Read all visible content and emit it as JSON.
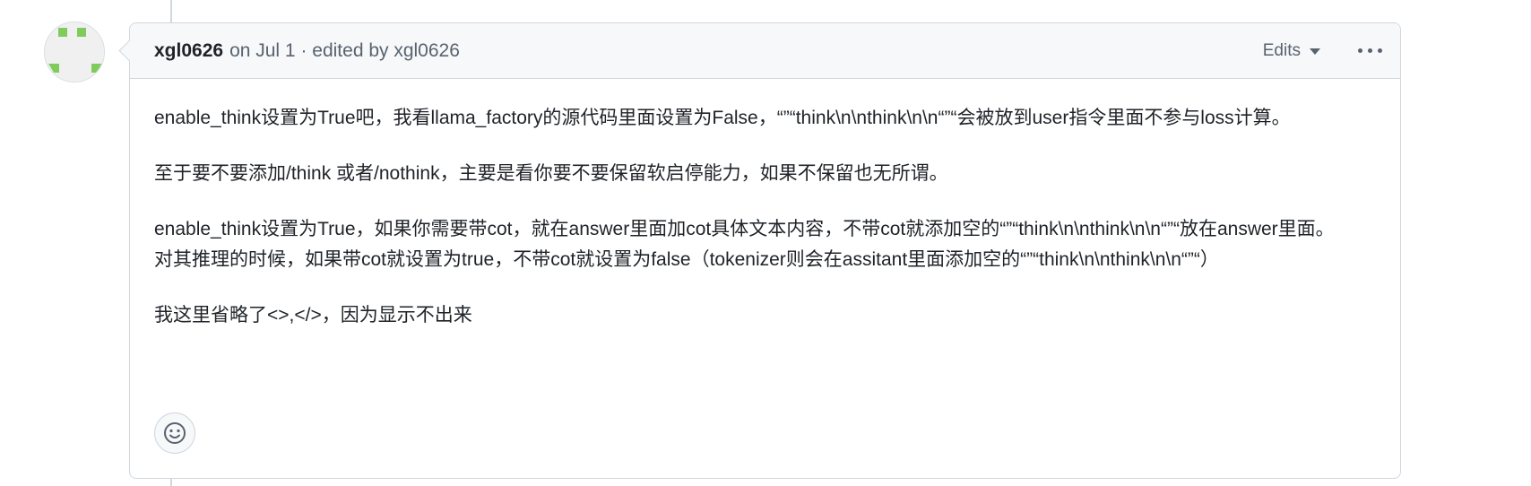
{
  "comment": {
    "author": "xgl0626",
    "meta": "on Jul 1 · edited by xgl0626",
    "edits_label": "Edits",
    "paragraphs": [
      "enable_think设置为True吧，我看llama_factory的源代码里面设置为False，“”“think\\n\\nthink\\n\\n“”“会被放到user指令里面不参与loss计算。",
      "至于要不要添加/think 或者/nothink，主要是看你要不要保留软启停能力，如果不保留也无所谓。",
      "enable_think设置为True，如果你需要带cot，就在answer里面加cot具体文本内容，不带cot就添加空的“”“think\\n\\nthink\\n\\n“”“放在answer里面。",
      "对其推理的时候，如果带cot就设置为true，不带cot就设置为false（tokenizer则会在assitant里面添加空的“”“think\\n\\nthink\\n\\n“”“）",
      "我这里省略了<>,</>，因为显示不出来"
    ]
  },
  "icons": {
    "avatar": "identicon-avatar",
    "edits_caret": "caret-down-icon",
    "more": "kebab-horizontal-icon",
    "reaction": "smiley-icon"
  },
  "colors": {
    "identicon": "#7fcc5c",
    "header_bg": "#f6f8fa",
    "border": "#d0d7de",
    "muted_text": "#59636e"
  }
}
